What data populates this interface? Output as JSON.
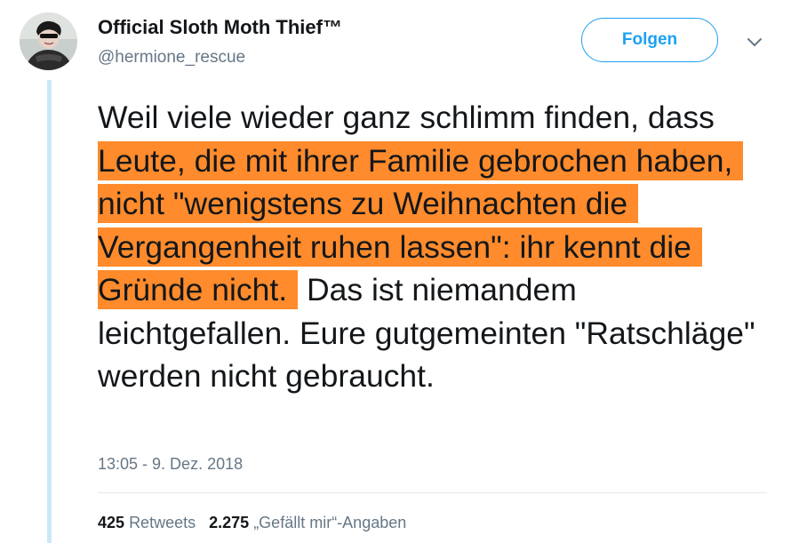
{
  "user": {
    "display_name": "Official Sloth Moth Thief™",
    "handle": "@hermione_rescue"
  },
  "follow_button_label": "Folgen",
  "tweet": {
    "text_before": "Weil viele wieder ganz schlimm finden, dass ",
    "text_highlighted": "Leute, die mit ihrer Familie gebrochen haben, nicht \"wenigstens zu Weihnachten die Vergangenheit ruhen lassen\": ihr kennt die Gründe nicht.",
    "text_after": " Das ist niemandem leichtgefallen. Eure gutgemeinten \"Ratschläge\" werden nicht gebraucht.",
    "highlight_color": "#ff8b2c",
    "timestamp": "13:05 - 9. Dez. 2018"
  },
  "stats": {
    "retweets_count": "425",
    "retweets_label": "Retweets",
    "likes_count": "2.275",
    "likes_label": "„Gefällt mir“-Angaben"
  },
  "colors": {
    "accent": "#1da1f2",
    "text": "#14171a",
    "secondary_text": "#657786",
    "thread_line": "#cce8f7"
  },
  "icons": {
    "caret": "chevron-down-icon",
    "avatar": "avatar"
  }
}
